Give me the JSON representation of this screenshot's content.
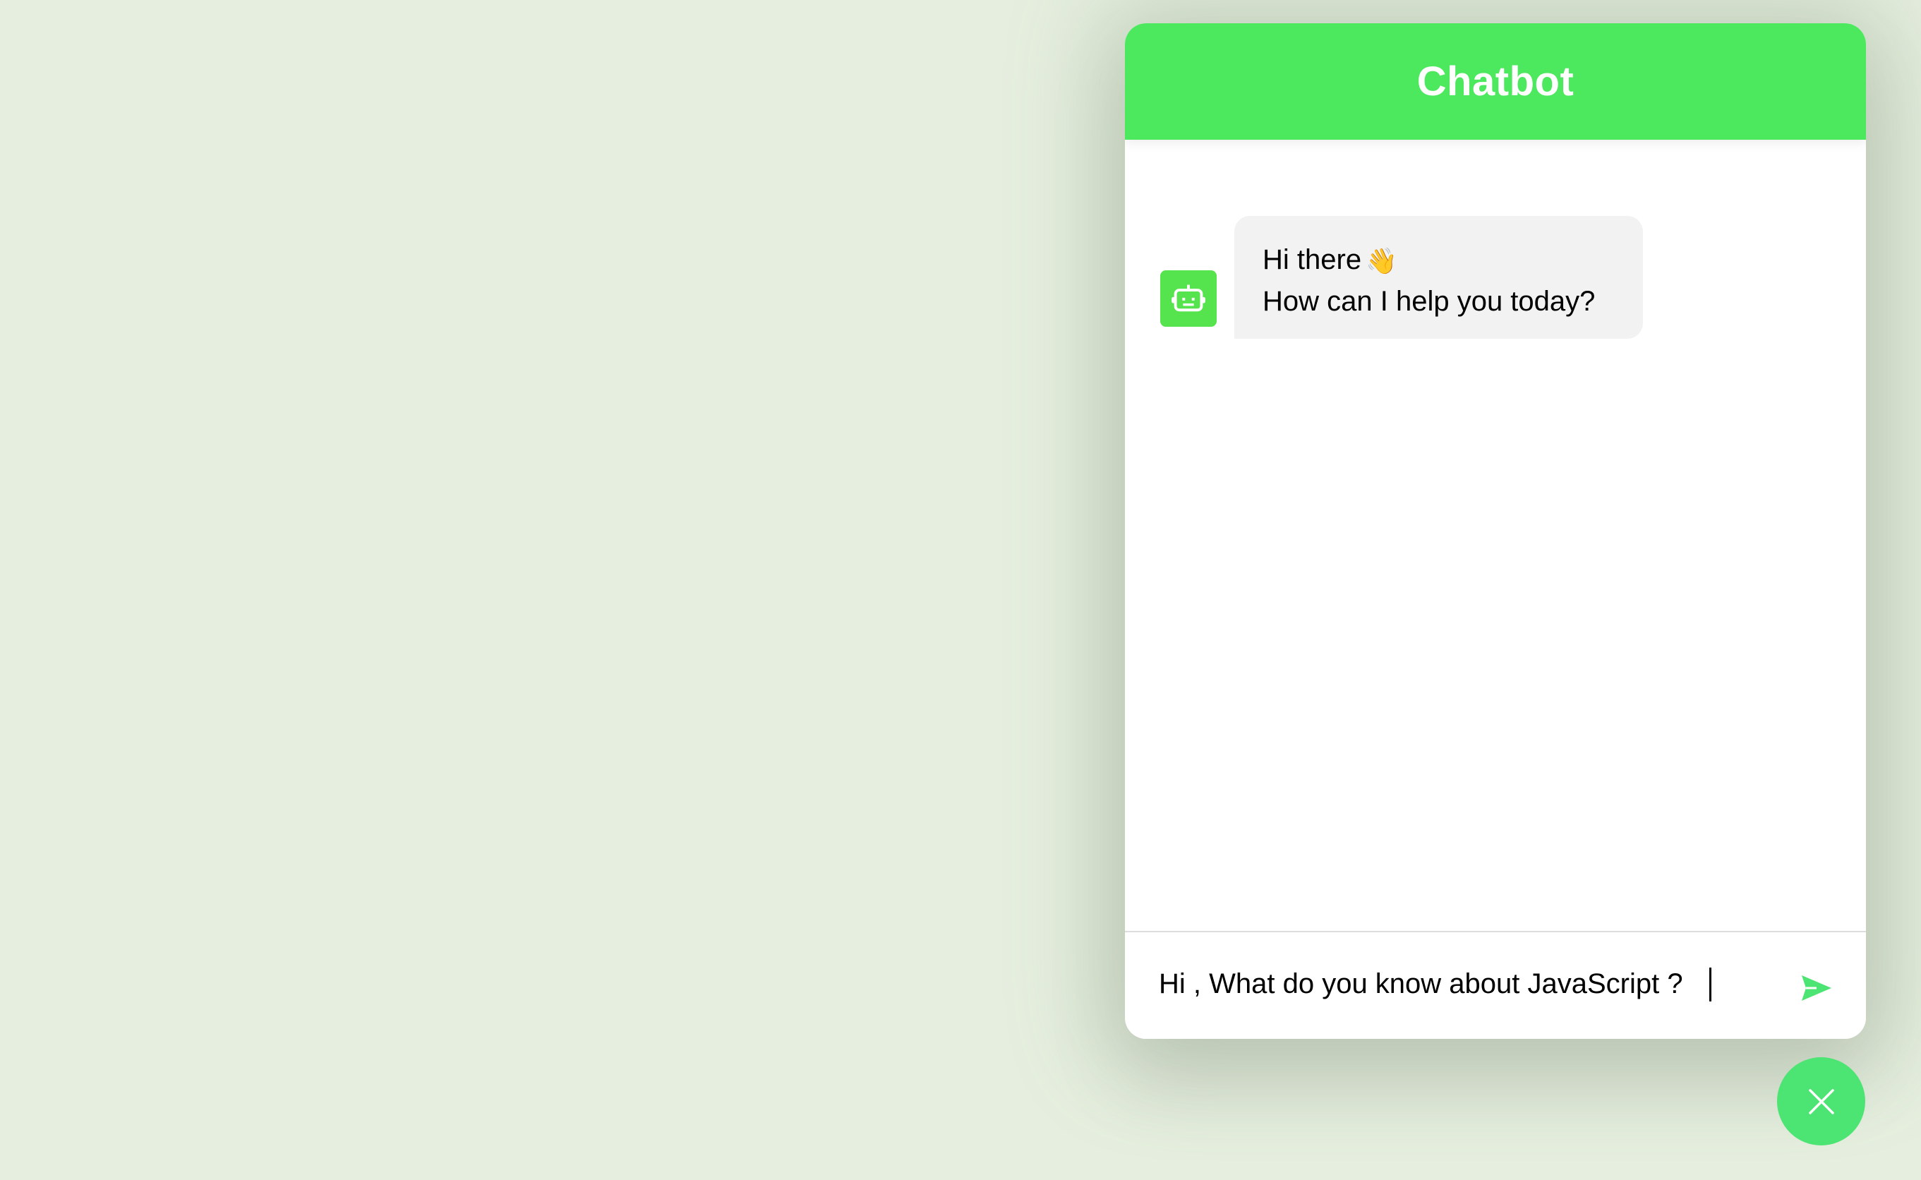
{
  "header": {
    "title": "Chatbot"
  },
  "messages": [
    {
      "sender": "bot",
      "lines": [
        "Hi there",
        "How can I help you today?"
      ],
      "emoji": "👋"
    }
  ],
  "input": {
    "value": "Hi , What do you know about JavaScript ?",
    "placeholder": ""
  },
  "icons": {
    "bot_avatar": "robot-icon",
    "send": "send-icon",
    "close": "close-icon",
    "wave": "waving-hand-icon"
  },
  "colors": {
    "accent": "#4ce95f",
    "toggler": "#4ce472",
    "avatar": "#56e44e",
    "bubble": "#f2f2f2",
    "background": "#e6efdf"
  }
}
